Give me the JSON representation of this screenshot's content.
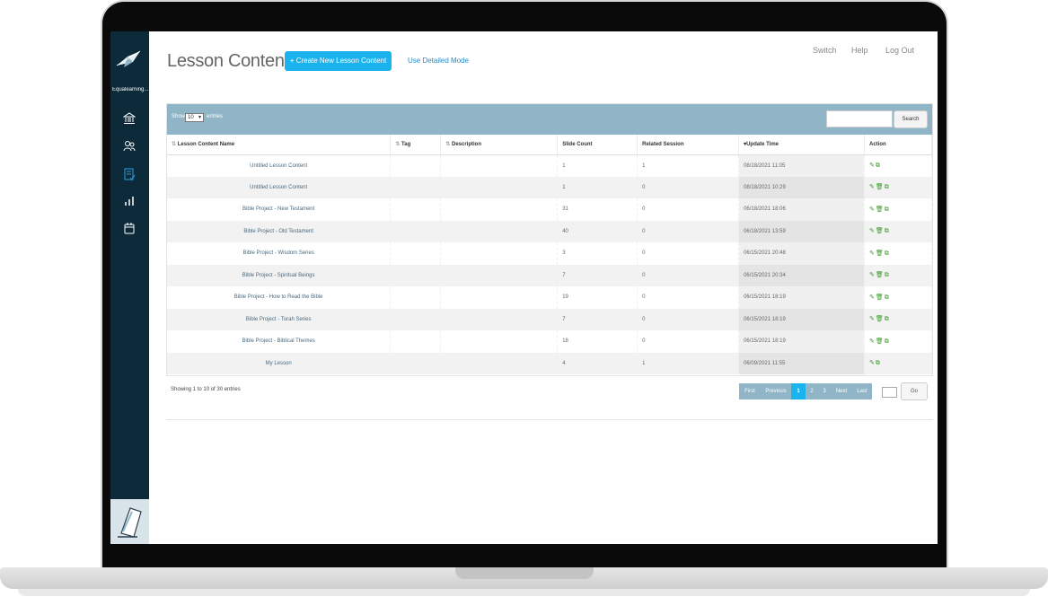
{
  "sidebar": {
    "brand": "Equalearning...",
    "icons": [
      "bank-icon",
      "users-icon",
      "lesson-checklist-icon",
      "chart-icon",
      "calendar-icon"
    ]
  },
  "header": {
    "title": "Lesson Contents",
    "create_label": "+ Create New Lesson Content",
    "detail_mode_label": "Use Detailed Mode",
    "nav": [
      "Switch",
      "Help",
      "Log Out"
    ]
  },
  "toolbar": {
    "show_label": "Show",
    "show_value": "10",
    "entries_label": "entries",
    "search_placeholder": "",
    "search_label": "Search"
  },
  "table": {
    "columns": [
      "Lesson Content Name",
      "Tag",
      "Description",
      "Slide Count",
      "Related Session",
      "Update Time",
      "Action"
    ],
    "rows": [
      {
        "name": "Untitled Lesson Content",
        "tag": "",
        "desc": "",
        "slides": "1",
        "session": "1",
        "time": "08/18/2021 11:05",
        "actions": "edit-copy"
      },
      {
        "name": "Untitled Lesson Content",
        "tag": "",
        "desc": "",
        "slides": "1",
        "session": "0",
        "time": "08/18/2021 10:29",
        "actions": "edit-delete-copy"
      },
      {
        "name": "Bible Project - New Testament",
        "tag": "",
        "desc": "",
        "slides": "31",
        "session": "0",
        "time": "06/18/2021 18:06",
        "actions": "edit-delete-copy"
      },
      {
        "name": "Bible Project - Old Testament",
        "tag": "",
        "desc": "",
        "slides": "40",
        "session": "0",
        "time": "06/18/2021 13:59",
        "actions": "edit-delete-copy"
      },
      {
        "name": "Bible Project - Wisdom Series",
        "tag": "",
        "desc": "",
        "slides": "3",
        "session": "0",
        "time": "06/15/2021 20:48",
        "actions": "edit-delete-copy"
      },
      {
        "name": "Bible Project - Spiritual Beings",
        "tag": "",
        "desc": "",
        "slides": "7",
        "session": "0",
        "time": "06/15/2021 20:34",
        "actions": "edit-delete-copy"
      },
      {
        "name": "Bible Project - How to Read the Bible",
        "tag": "",
        "desc": "",
        "slides": "19",
        "session": "0",
        "time": "06/15/2021 18:19",
        "actions": "edit-delete-copy"
      },
      {
        "name": "Bible Project - Torah Series",
        "tag": "",
        "desc": "",
        "slides": "7",
        "session": "0",
        "time": "06/15/2021 18:19",
        "actions": "edit-delete-copy"
      },
      {
        "name": "Bible Project - Biblical Themes",
        "tag": "",
        "desc": "",
        "slides": "18",
        "session": "0",
        "time": "06/15/2021 18:19",
        "actions": "edit-delete-copy"
      },
      {
        "name": "My Lesson",
        "tag": "",
        "desc": "",
        "slides": "4",
        "session": "1",
        "time": "06/09/2021 11:55",
        "actions": "edit-copy"
      }
    ]
  },
  "footer": {
    "info": "Showing 1 to 10 of 30 entries",
    "pages": [
      "First",
      "Previous",
      "1",
      "2",
      "3",
      "Next",
      "Last"
    ],
    "active_page": "1",
    "go_label": "Go"
  },
  "colors": {
    "sidebar_bg": "#0d2a3a",
    "accent": "#1bb3ee",
    "toolbar_bg": "#8fb5c6",
    "action_icon": "#3a9a2a"
  }
}
